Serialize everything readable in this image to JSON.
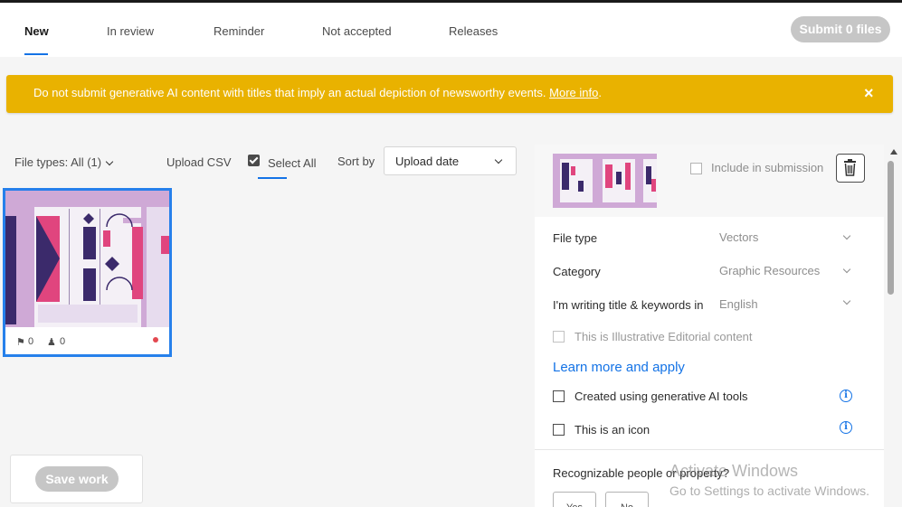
{
  "tabs": [
    {
      "label": "New",
      "active": true
    },
    {
      "label": "In review",
      "active": false
    },
    {
      "label": "Reminder",
      "active": false
    },
    {
      "label": "Not accepted",
      "active": false
    },
    {
      "label": "Releases",
      "active": false
    }
  ],
  "header": {
    "submit_label": "Submit 0 files"
  },
  "banner": {
    "text": "Do not submit generative AI content with titles that imply an actual depiction of newsworthy events. ",
    "link": "More info",
    "link_suffix": ".",
    "close_icon": "close-icon",
    "color": "#e9b200"
  },
  "toolbar": {
    "file_types": "File types: All (1)",
    "upload_csv": "Upload CSV",
    "select_all": "Select All",
    "select_all_checked": true,
    "sort_by_label": "Sort by",
    "sort_value": "Upload date"
  },
  "thumbnail": {
    "keywords_count": "0",
    "people_count": "0",
    "status_color": "#e34850",
    "selected": true
  },
  "save": {
    "label": "Save work"
  },
  "panel": {
    "include_label": "Include in submission",
    "include_checked": false,
    "trash_icon": "trash-icon",
    "file_type_label": "File type",
    "file_type_value": "Vectors",
    "category_label": "Category",
    "category_value": "Graphic Resources",
    "language_label": "I'm writing title & keywords in",
    "language_value": "English",
    "editorial_label": "This is Illustrative Editorial content",
    "learn_more": "Learn more and apply",
    "generative_label": "Created using generative AI tools",
    "icon_label": "This is an icon",
    "recognizable_label": "Recognizable people or property?",
    "yes_label": "Yes",
    "no_label": "No"
  },
  "watermark": {
    "line1": "Activate Windows",
    "line2": "Go to Settings to activate Windows."
  },
  "colors": {
    "accent": "#1473e6",
    "selection": "#2680eb"
  }
}
